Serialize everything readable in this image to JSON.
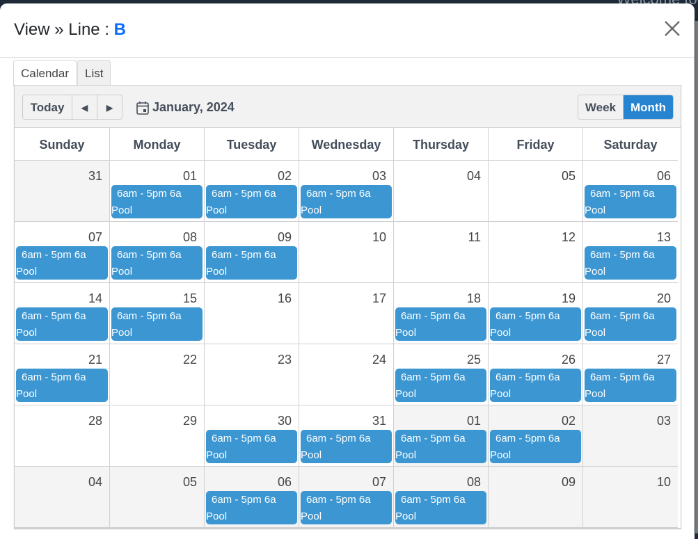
{
  "backdrop": {
    "text": "Welcome to"
  },
  "modal": {
    "title_prefix": "View » Line : ",
    "title_value": "B",
    "accent_color": "#0d6efd"
  },
  "tabs": [
    {
      "label": "Calendar",
      "active": true
    },
    {
      "label": "List",
      "active": false
    }
  ],
  "toolbar": {
    "today_label": "Today",
    "prev_icon": "◀",
    "next_icon": "▶",
    "date_title": "January, 2024",
    "week_label": "Week",
    "month_label": "Month",
    "active_view": "Month"
  },
  "weekdays": [
    "Sunday",
    "Monday",
    "Tuesday",
    "Wednesday",
    "Thursday",
    "Friday",
    "Saturday"
  ],
  "event_color": "#3b96d2",
  "weeks": [
    [
      {
        "day": "31",
        "other": true,
        "event": null
      },
      {
        "day": "01",
        "other": false,
        "event": {
          "time": "6am - 5pm 6a",
          "name": "Pool"
        }
      },
      {
        "day": "02",
        "other": false,
        "event": {
          "time": "6am - 5pm 6a",
          "name": "Pool"
        }
      },
      {
        "day": "03",
        "other": false,
        "event": {
          "time": "6am - 5pm 6a",
          "name": "Pool"
        }
      },
      {
        "day": "04",
        "other": false,
        "event": null
      },
      {
        "day": "05",
        "other": false,
        "event": null
      },
      {
        "day": "06",
        "other": false,
        "event": {
          "time": "6am - 5pm 6a",
          "name": "Pool"
        }
      }
    ],
    [
      {
        "day": "07",
        "other": false,
        "event": {
          "time": "6am - 5pm 6a",
          "name": "Pool"
        }
      },
      {
        "day": "08",
        "other": false,
        "event": {
          "time": "6am - 5pm 6a",
          "name": "Pool"
        }
      },
      {
        "day": "09",
        "other": false,
        "event": {
          "time": "6am - 5pm 6a",
          "name": "Pool"
        }
      },
      {
        "day": "10",
        "other": false,
        "event": null
      },
      {
        "day": "11",
        "other": false,
        "event": null
      },
      {
        "day": "12",
        "other": false,
        "event": null
      },
      {
        "day": "13",
        "other": false,
        "event": {
          "time": "6am - 5pm 6a",
          "name": "Pool"
        }
      }
    ],
    [
      {
        "day": "14",
        "other": false,
        "event": {
          "time": "6am - 5pm 6a",
          "name": "Pool"
        }
      },
      {
        "day": "15",
        "other": false,
        "event": {
          "time": "6am - 5pm 6a",
          "name": "Pool"
        }
      },
      {
        "day": "16",
        "other": false,
        "event": null
      },
      {
        "day": "17",
        "other": false,
        "event": null
      },
      {
        "day": "18",
        "other": false,
        "event": {
          "time": "6am - 5pm 6a",
          "name": "Pool"
        }
      },
      {
        "day": "19",
        "other": false,
        "event": {
          "time": "6am - 5pm 6a",
          "name": "Pool"
        }
      },
      {
        "day": "20",
        "other": false,
        "event": {
          "time": "6am - 5pm 6a",
          "name": "Pool"
        }
      }
    ],
    [
      {
        "day": "21",
        "other": false,
        "event": {
          "time": "6am - 5pm 6a",
          "name": "Pool"
        }
      },
      {
        "day": "22",
        "other": false,
        "event": null
      },
      {
        "day": "23",
        "other": false,
        "event": null
      },
      {
        "day": "24",
        "other": false,
        "event": null
      },
      {
        "day": "25",
        "other": false,
        "event": {
          "time": "6am - 5pm 6a",
          "name": "Pool"
        }
      },
      {
        "day": "26",
        "other": false,
        "event": {
          "time": "6am - 5pm 6a",
          "name": "Pool"
        }
      },
      {
        "day": "27",
        "other": false,
        "event": {
          "time": "6am - 5pm 6a",
          "name": "Pool"
        }
      }
    ],
    [
      {
        "day": "28",
        "other": false,
        "event": null
      },
      {
        "day": "29",
        "other": false,
        "event": null
      },
      {
        "day": "30",
        "other": false,
        "event": {
          "time": "6am - 5pm 6a",
          "name": "Pool"
        }
      },
      {
        "day": "31",
        "other": false,
        "event": {
          "time": "6am - 5pm 6a",
          "name": "Pool"
        }
      },
      {
        "day": "01",
        "other": true,
        "event": {
          "time": "6am - 5pm 6a",
          "name": "Pool"
        }
      },
      {
        "day": "02",
        "other": true,
        "event": {
          "time": "6am - 5pm 6a",
          "name": "Pool"
        }
      },
      {
        "day": "03",
        "other": true,
        "event": null
      }
    ],
    [
      {
        "day": "04",
        "other": true,
        "event": null
      },
      {
        "day": "05",
        "other": true,
        "event": null
      },
      {
        "day": "06",
        "other": true,
        "event": {
          "time": "6am - 5pm 6a",
          "name": "Pool"
        }
      },
      {
        "day": "07",
        "other": true,
        "event": {
          "time": "6am - 5pm 6a",
          "name": "Pool"
        }
      },
      {
        "day": "08",
        "other": true,
        "event": {
          "time": "6am - 5pm 6a",
          "name": "Pool"
        }
      },
      {
        "day": "09",
        "other": true,
        "event": null
      },
      {
        "day": "10",
        "other": true,
        "event": null
      }
    ]
  ]
}
